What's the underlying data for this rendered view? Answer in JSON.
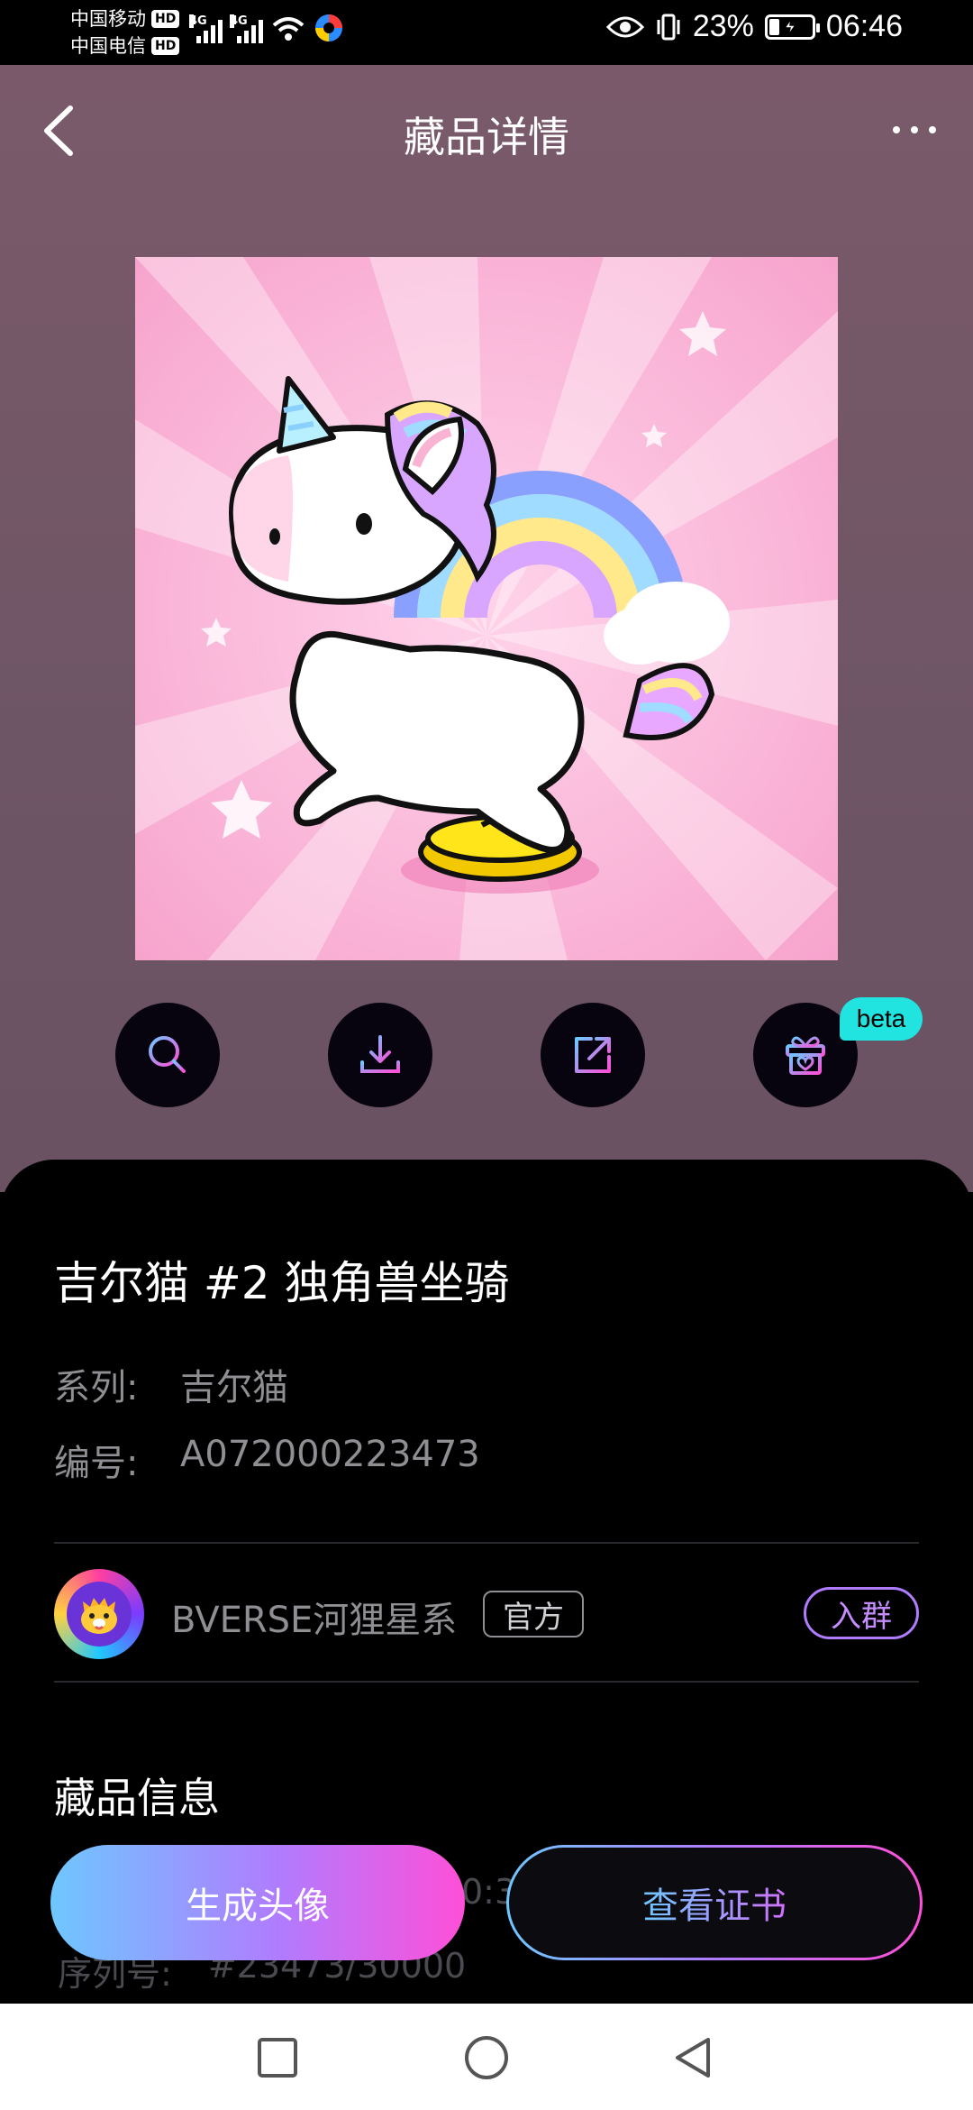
{
  "status_bar": {
    "carrier1": "中国移动",
    "carrier2": "中国电信",
    "hd": "HD",
    "net1": "4G",
    "net2": "4G",
    "battery": "23%",
    "time": "06:46"
  },
  "nav": {
    "title": "藏品详情"
  },
  "actions": {
    "beta_badge": "beta",
    "icons": [
      "search-icon",
      "download-icon",
      "share-icon",
      "gift-icon"
    ]
  },
  "item": {
    "title": "吉尔猫 #2 独角兽坐骑",
    "series_label": "系列:",
    "series_value": "吉尔猫",
    "code_label": "编号:",
    "code_value": "A072000223473"
  },
  "creator": {
    "name": "BVERSE河狸星系",
    "badge": "官方",
    "join": "入群"
  },
  "info": {
    "section_title": "藏品信息",
    "peek_time": "0:3",
    "serial_label": "序列号:",
    "serial_value": "#23473/30000"
  },
  "buttons": {
    "generate_avatar": "生成头像",
    "view_certificate": "查看证书"
  },
  "colors": {
    "hero_bg": "#7a5a6a",
    "beta": "#21e3e0",
    "accent_gradient_start": "#6ec7ff",
    "accent_gradient_end": "#ff4fd8"
  }
}
